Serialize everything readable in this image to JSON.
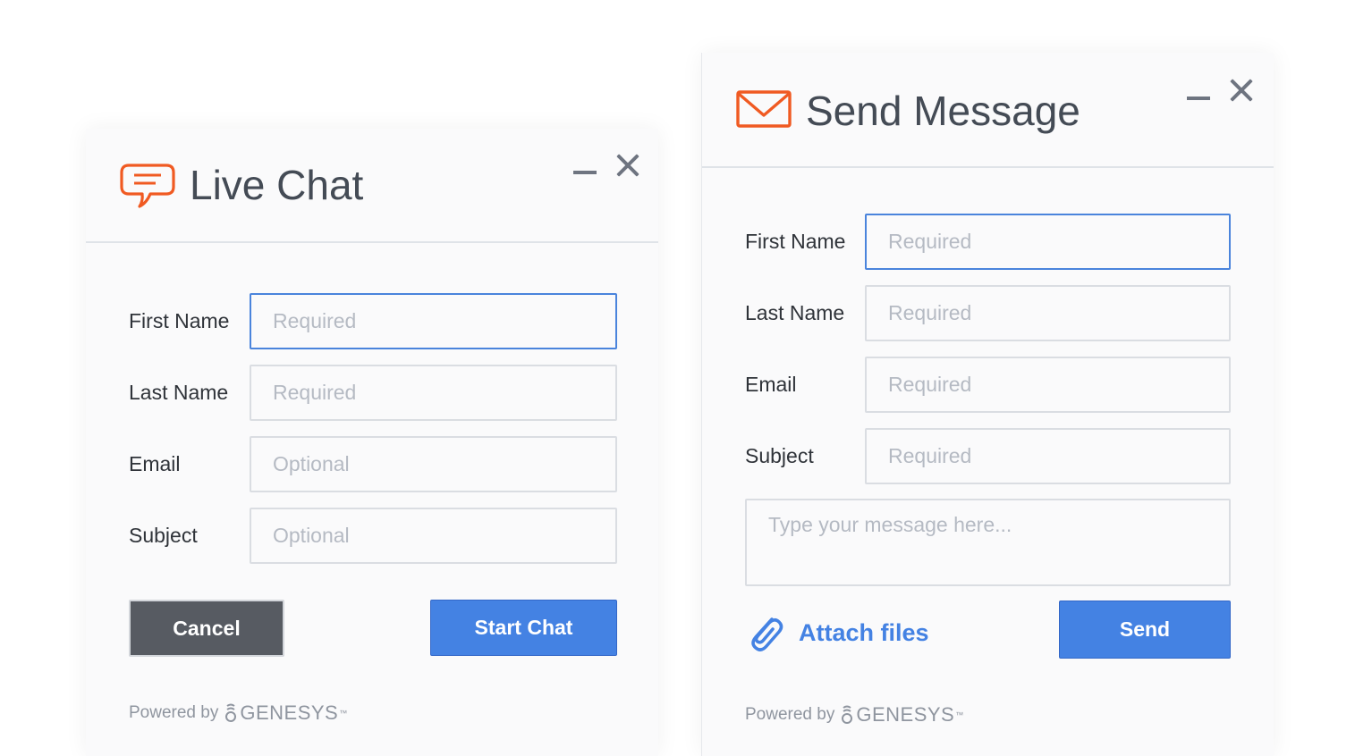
{
  "live_chat": {
    "title": "Live Chat",
    "icon": "chat-bubble-icon",
    "accent_color": "#f05a22",
    "fields": [
      {
        "label": "First Name",
        "placeholder": "Required"
      },
      {
        "label": "Last Name",
        "placeholder": "Required"
      },
      {
        "label": "Email",
        "placeholder": "Optional"
      },
      {
        "label": "Subject",
        "placeholder": "Optional"
      }
    ],
    "cancel_label": "Cancel",
    "start_label": "Start Chat",
    "powered_by": "Powered by",
    "brand": "GENESYS"
  },
  "send_message": {
    "title": "Send Message",
    "icon": "envelope-icon",
    "accent_color": "#f05a22",
    "fields": [
      {
        "label": "First Name",
        "placeholder": "Required"
      },
      {
        "label": "Last Name",
        "placeholder": "Required"
      },
      {
        "label": "Email",
        "placeholder": "Required"
      },
      {
        "label": "Subject",
        "placeholder": "Required"
      }
    ],
    "message_placeholder": "Type your message here...",
    "attach_label": "Attach files",
    "send_label": "Send",
    "powered_by": "Powered by",
    "brand": "GENESYS"
  },
  "colors": {
    "primary_button": "#4482e3",
    "cancel_button": "#575b62",
    "focus_border": "#4a84dc"
  }
}
